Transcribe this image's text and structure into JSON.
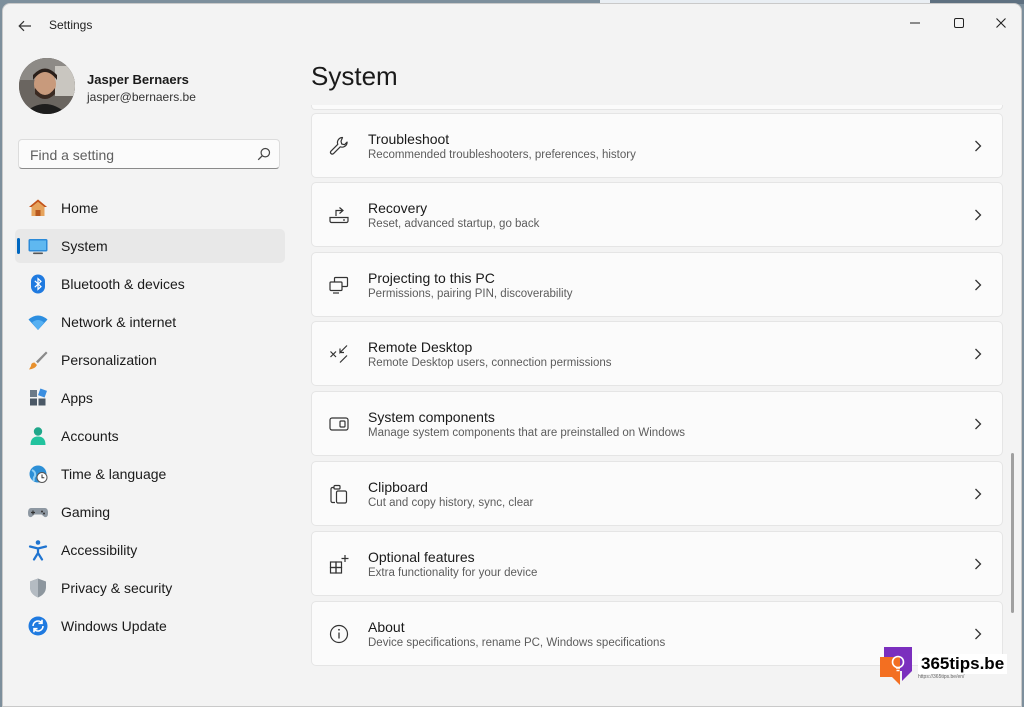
{
  "app": {
    "title": "Settings"
  },
  "profile": {
    "name": "Jasper Bernaers",
    "email": "jasper@bernaers.be"
  },
  "search": {
    "placeholder": "Find a setting"
  },
  "nav": [
    {
      "label": "Home",
      "icon": "home-icon"
    },
    {
      "label": "System",
      "icon": "system-icon",
      "active": true
    },
    {
      "label": "Bluetooth & devices",
      "icon": "bluetooth-icon"
    },
    {
      "label": "Network & internet",
      "icon": "wifi-icon"
    },
    {
      "label": "Personalization",
      "icon": "brush-icon"
    },
    {
      "label": "Apps",
      "icon": "apps-icon"
    },
    {
      "label": "Accounts",
      "icon": "person-icon"
    },
    {
      "label": "Time & language",
      "icon": "globe-clock-icon"
    },
    {
      "label": "Gaming",
      "icon": "gamepad-icon"
    },
    {
      "label": "Accessibility",
      "icon": "accessibility-icon"
    },
    {
      "label": "Privacy & security",
      "icon": "shield-icon"
    },
    {
      "label": "Windows Update",
      "icon": "update-icon"
    }
  ],
  "page": {
    "title": "System"
  },
  "cards": [
    {
      "title": "Troubleshoot",
      "subtitle": "Recommended troubleshooters, preferences, history",
      "icon": "wrench-icon"
    },
    {
      "title": "Recovery",
      "subtitle": "Reset, advanced startup, go back",
      "icon": "recovery-icon"
    },
    {
      "title": "Projecting to this PC",
      "subtitle": "Permissions, pairing PIN, discoverability",
      "icon": "projecting-icon"
    },
    {
      "title": "Remote Desktop",
      "subtitle": "Remote Desktop users, connection permissions",
      "icon": "remote-desktop-icon"
    },
    {
      "title": "System components",
      "subtitle": "Manage system components that are preinstalled on Windows",
      "icon": "components-icon"
    },
    {
      "title": "Clipboard",
      "subtitle": "Cut and copy history, sync, clear",
      "icon": "clipboard-icon"
    },
    {
      "title": "Optional features",
      "subtitle": "Extra functionality for your device",
      "icon": "optional-features-icon"
    },
    {
      "title": "About",
      "subtitle": "Device specifications, rename PC, Windows specifications",
      "icon": "info-icon"
    }
  ],
  "watermark": {
    "name": "365tips.be",
    "url": "https://365tips.be/en/"
  },
  "colors": {
    "accent": "#0067c0",
    "window_bg": "#f3f3f3",
    "card_bg": "#fbfbfb"
  }
}
